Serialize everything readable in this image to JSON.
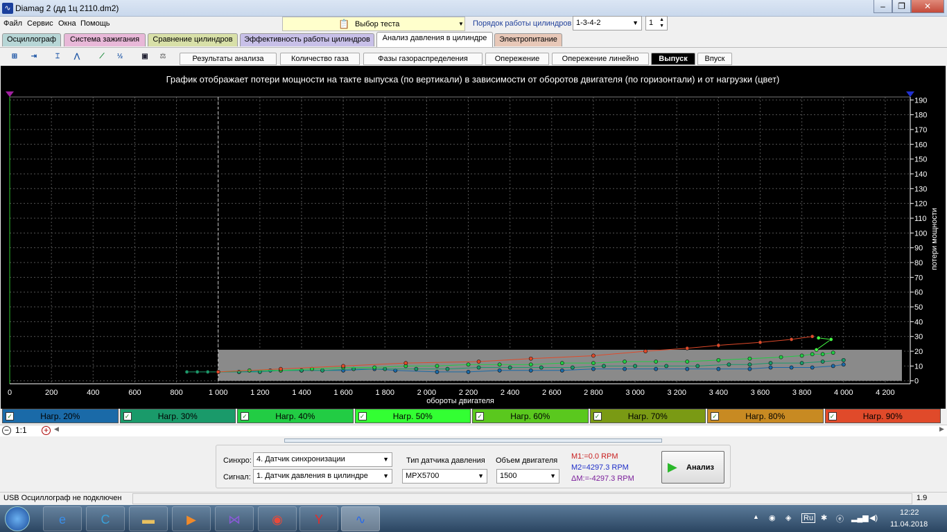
{
  "window": {
    "title": "Diamag 2 (дд 1ц 2110.dm2)",
    "minimize": "‒",
    "maximize": "❐",
    "close": "✕"
  },
  "menu": [
    "Файл",
    "Сервис",
    "Окна",
    "Помощь"
  ],
  "test_select": {
    "label": "Выбор теста"
  },
  "cyl_order": {
    "label": "Порядок работы цилиндров",
    "value": "1-3-4-2",
    "cyl_num": "1"
  },
  "tabs": [
    {
      "label": "Осциллограф",
      "color": "#b7d6d6"
    },
    {
      "label": "Система зажигания",
      "color": "#e8b8d8"
    },
    {
      "label": "Сравнение цилиндров",
      "color": "#d8e0a8"
    },
    {
      "label": "Эффективность работы цилиндров",
      "color": "#c8c0e8"
    },
    {
      "label": "Анализ давления в цилиндре",
      "color": "#ffffff"
    },
    {
      "label": "Электропитание",
      "color": "#e8c8b8"
    }
  ],
  "subtabs": [
    "Результаты анализа",
    "Количество газа",
    "Фазы газораспределения",
    "Опережение",
    "Опережение линейно",
    "Выпуск",
    "Впуск"
  ],
  "active_subtab": "Выпуск",
  "chart_data": {
    "type": "scatter",
    "title": "График отображает потери мощности на такте выпуска (по вертикали) в зависимости от оборотов двигателя (по горизонтали) и от нагрузки (цвет)",
    "xlabel": "обороты двигателя",
    "ylabel": "потери мощности",
    "xlim": [
      0,
      4320
    ],
    "ylim": [
      -2,
      192
    ],
    "x_ticks": [
      "0",
      "200",
      "400",
      "600",
      "800",
      "1 000",
      "1 200",
      "1 400",
      "1 600",
      "1 800",
      "2 000",
      "2 200",
      "2 400",
      "2 600",
      "2 800",
      "3 000",
      "3 200",
      "3 400",
      "3 600",
      "3 800",
      "4 000",
      "4 200"
    ],
    "x_tick_values": [
      0,
      200,
      400,
      600,
      800,
      1000,
      1200,
      1400,
      1600,
      1800,
      2000,
      2200,
      2400,
      2600,
      2800,
      3000,
      3200,
      3400,
      3600,
      3800,
      4000,
      4200
    ],
    "y_ticks": [
      0,
      10,
      20,
      30,
      40,
      50,
      60,
      70,
      80,
      90,
      100,
      110,
      120,
      130,
      140,
      150,
      160,
      170,
      180,
      190
    ],
    "marker_line_x": 1000,
    "gray_band": {
      "x": [
        1000,
        4280
      ],
      "y": [
        0,
        21
      ]
    },
    "series": [
      {
        "name": "Нагр. 20%",
        "color": "#1a6aa8",
        "x": [
          1000,
          1100,
          1250,
          1400,
          1600,
          1750,
          1850,
          2050,
          2200,
          2350,
          2500,
          2650,
          2800,
          2950,
          3100,
          3250,
          3400,
          3550,
          3650,
          3750,
          3850,
          3950,
          4000
        ],
        "y": [
          6,
          6,
          7,
          7,
          7,
          8,
          7,
          6,
          6,
          7,
          7,
          7,
          8,
          8,
          8,
          8,
          8,
          8,
          9,
          9,
          9,
          10,
          11
        ]
      },
      {
        "name": "Нагр. 30%",
        "color": "#1a9a6a",
        "x": [
          850,
          900,
          950,
          1000,
          1100,
          1200,
          1300,
          1400,
          1500,
          1650,
          1800,
          1950,
          2100,
          2250,
          2400,
          2550,
          2700,
          2850,
          3000,
          3150,
          3300,
          3450,
          3550,
          3650,
          3800,
          3900,
          4000
        ],
        "y": [
          6,
          6,
          6,
          6,
          6,
          6,
          7,
          7,
          7,
          8,
          8,
          8,
          8,
          9,
          9,
          9,
          9,
          10,
          10,
          10,
          10,
          11,
          11,
          12,
          12,
          13,
          14
        ]
      },
      {
        "name": "Нагр. 40%",
        "color": "#22cc44",
        "x": [
          1000,
          1150,
          1300,
          1450,
          1600,
          1750,
          1900,
          2050,
          2200,
          2350,
          2500,
          2650,
          2800,
          2950,
          3100,
          3250,
          3400,
          3550,
          3700,
          3800,
          3850,
          3900,
          3950
        ],
        "y": [
          6,
          7,
          7,
          8,
          9,
          9,
          10,
          10,
          11,
          11,
          11,
          12,
          12,
          13,
          13,
          13,
          14,
          15,
          16,
          17,
          18,
          18,
          19
        ]
      },
      {
        "name": "Нагр. 50%",
        "color": "#44ff44",
        "x": [
          3880,
          3940,
          3870
        ],
        "y": [
          29,
          28,
          21
        ]
      },
      {
        "name": "Нагр. 90%",
        "color": "#e04a2a",
        "x": [
          1000,
          1300,
          1600,
          1900,
          2250,
          2500,
          2800,
          3050,
          3250,
          3400,
          3600,
          3750,
          3850
        ],
        "y": [
          6,
          8,
          10,
          12,
          13,
          15,
          17,
          20,
          22,
          24,
          26,
          28,
          30
        ]
      }
    ]
  },
  "legend": [
    {
      "label": "Нагр. 20%",
      "color": "#1a6aa8"
    },
    {
      "label": "Нагр. 30%",
      "color": "#1a9a6a"
    },
    {
      "label": "Нагр. 40%",
      "color": "#22cc44"
    },
    {
      "label": "Нагр. 50%",
      "color": "#33ff33"
    },
    {
      "label": "Нагр. 60%",
      "color": "#5ac81e"
    },
    {
      "label": "Нагр. 70%",
      "color": "#7a9a14"
    },
    {
      "label": "Нагр. 80%",
      "color": "#c88a22"
    },
    {
      "label": "Нагр. 90%",
      "color": "#e04a2a"
    }
  ],
  "zoom": {
    "ratio": "1:1"
  },
  "panel": {
    "sync_label": "Синхро:",
    "sync_value": "4.  Датчик синхронизации",
    "signal_label": "Сигнал:",
    "signal_value": "1.  Датчик давления в цилиндре",
    "sensor_label": "Тип датчика давления",
    "sensor_value": "MPX5700",
    "volume_label": "Объем двигателя",
    "volume_value": "1500",
    "m1": "M1:=0.0 RPM",
    "m2": "M2=4297.3 RPM",
    "dm": "ΔM:=-4297.3 RPM",
    "analyze": "Анализ"
  },
  "status": {
    "text": "USB Осциллограф не подключен",
    "version": "1.9"
  },
  "tray": {
    "lang": "Ru",
    "time": "12:22",
    "date": "11.04.2018"
  },
  "taskbar_apps": [
    {
      "icon": "ie-icon",
      "glyph": "e",
      "color": "#3a8ee8"
    },
    {
      "icon": "ccleaner-icon",
      "glyph": "C",
      "color": "#3aa0d8"
    },
    {
      "icon": "folder-icon",
      "glyph": "▬",
      "color": "#e8c060"
    },
    {
      "icon": "media-player-icon",
      "glyph": "▶",
      "color": "#f08a2a"
    },
    {
      "icon": "visual-studio-icon",
      "glyph": "⋈",
      "color": "#8a5ad8"
    },
    {
      "icon": "chrome-icon",
      "glyph": "◉",
      "color": "#e84a3a"
    },
    {
      "icon": "yandex-icon",
      "glyph": "Y",
      "color": "#e82a2a"
    },
    {
      "icon": "diamag-icon",
      "glyph": "∿",
      "color": "#2a6ae8"
    }
  ]
}
